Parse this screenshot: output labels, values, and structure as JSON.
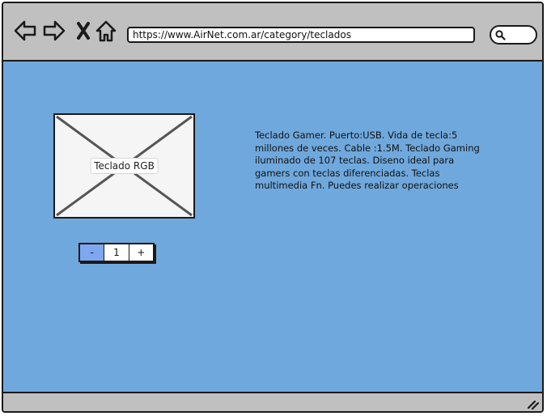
{
  "browser": {
    "url": "https://www.AirNet.com.ar/category/teclados",
    "nav_icons": [
      "back-arrow-icon",
      "forward-arrow-icon",
      "close-icon",
      "home-icon"
    ],
    "search_icon": "search-icon"
  },
  "product": {
    "image_label": "Teclado RGB",
    "description": "Teclado Gamer. Puerto:USB. Vida de tecla:5 millones de veces. Cable :1.5M. Teclado Gaming iluminado de 107 teclas. Diseno ideal para gamers con teclas diferenciadas. Teclas multimedia Fn. Puedes realizar operaciones"
  },
  "quantity": {
    "minus_label": "-",
    "value": "1",
    "plus_label": "+"
  },
  "colors": {
    "page_background": "#6fa8dc",
    "chrome": "#c0c0c0",
    "stepper_minus": "#7da7f0"
  }
}
